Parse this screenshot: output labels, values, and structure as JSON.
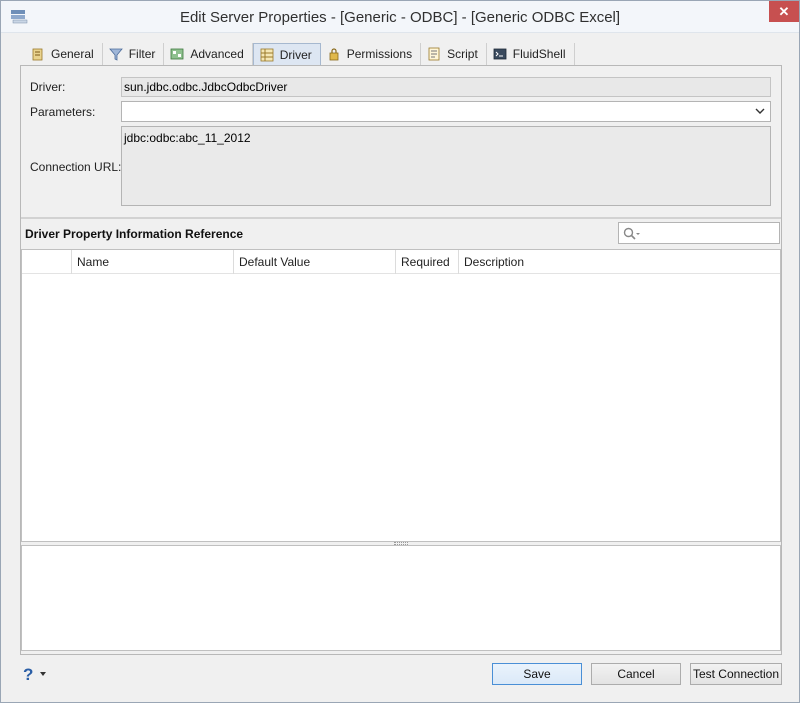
{
  "window": {
    "title": "Edit Server Properties - [Generic - ODBC] - [Generic ODBC Excel]",
    "close_label": "✕"
  },
  "tabs": [
    {
      "label": "General",
      "icon": "general-icon"
    },
    {
      "label": "Filter",
      "icon": "filter-icon"
    },
    {
      "label": "Advanced",
      "icon": "advanced-icon"
    },
    {
      "label": "Driver",
      "icon": "driver-icon",
      "active": true
    },
    {
      "label": "Permissions",
      "icon": "permissions-icon"
    },
    {
      "label": "Script",
      "icon": "script-icon"
    },
    {
      "label": "FluidShell",
      "icon": "fluidshell-icon"
    }
  ],
  "form": {
    "driver_label": "Driver:",
    "driver_value": "sun.jdbc.odbc.JdbcOdbcDriver",
    "parameters_label": "Parameters:",
    "parameters_value": "",
    "url_label": "Connection URL:",
    "url_value": "jdbc:odbc:abc_11_2012"
  },
  "reference": {
    "title": "Driver Property Information Reference",
    "search_value": "",
    "columns": [
      "",
      "Name",
      "Default Value",
      "Required",
      "Description"
    ],
    "rows": []
  },
  "footer": {
    "help_label": "?",
    "save_label": "Save",
    "cancel_label": "Cancel",
    "test_label": "Test Connection"
  },
  "colors": {
    "active_tab": "#dde6f2",
    "close_button": "#c75050",
    "primary_border": "#4a8fd6"
  }
}
